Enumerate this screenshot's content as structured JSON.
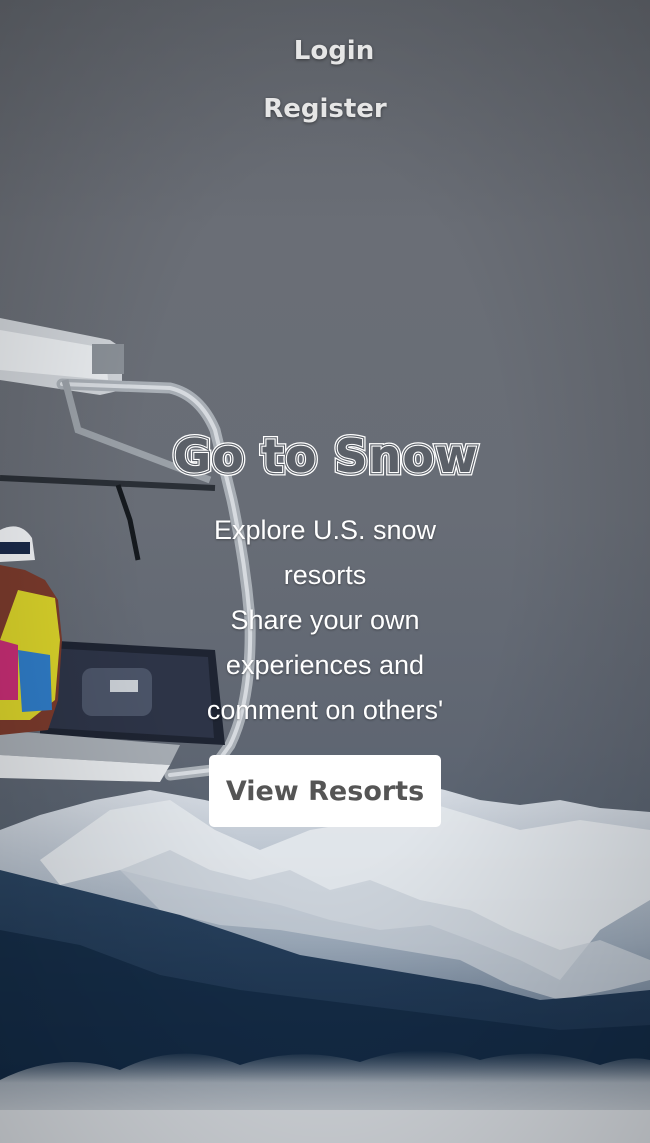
{
  "nav": {
    "login_label": "Login",
    "register_label": "Register"
  },
  "hero": {
    "title": "Go to Snow",
    "tagline_line1": "Explore U.S. snow resorts",
    "tagline_line2": "Share your own experiences and comment on others'",
    "cta_label": "View Resorts"
  },
  "background": {
    "description_icon": "ski-lift-mountain-photo"
  },
  "colors": {
    "button_bg": "#ffffff",
    "button_text": "#555555",
    "nav_text": "#e6e6e6",
    "sky": "#686d76",
    "mountain_snow": "#dfe4ea",
    "mountain_forest": "#1f3550"
  }
}
